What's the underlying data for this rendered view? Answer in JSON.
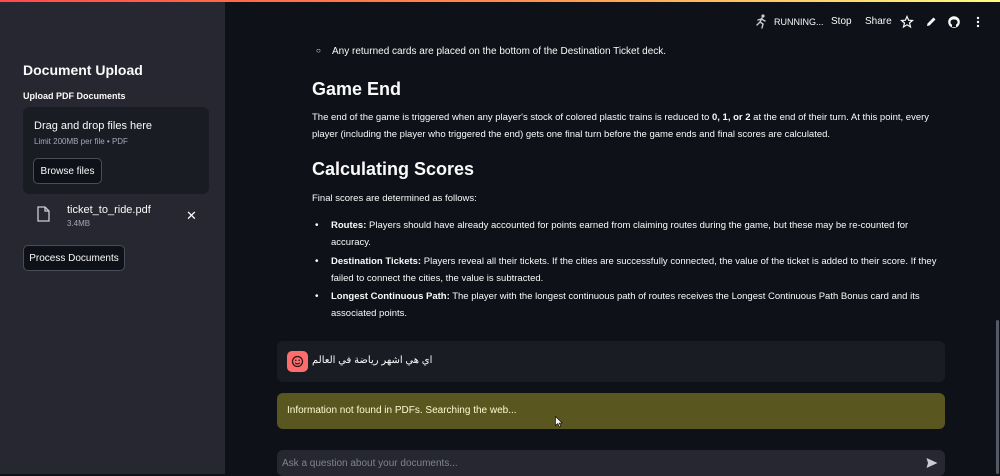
{
  "sidebar": {
    "title": "Document Upload",
    "upload_label": "Upload PDF Documents",
    "dropzone_title": "Drag and drop files here",
    "dropzone_sub": "Limit 200MB per file • PDF",
    "browse_label": "Browse files",
    "file": {
      "name": "ticket_to_ride.pdf",
      "size": "3.4MB",
      "close": "✕"
    },
    "process_label": "Process Documents"
  },
  "header": {
    "status": "RUNNING...",
    "stop_label": "Stop",
    "share_label": "Share",
    "icons": [
      "runner-icon",
      "star-icon",
      "pencil-icon",
      "github-icon",
      "more-icon"
    ]
  },
  "main": {
    "prev_item": "Any returned cards are placed on the bottom of the Destination Ticket deck.",
    "game_end_heading": "Game End",
    "game_end_text_a": "The end of the game is triggered when any player's stock of colored plastic trains is reduced to ",
    "game_end_text_bold": "0, 1, or 2",
    "game_end_text_b": " at the end of their turn. At this point, every player (including the player who triggered the end) gets one final turn before the game ends and final scores are calculated.",
    "scores_heading": "Calculating Scores",
    "scores_intro": "Final scores are determined as follows:",
    "bullets": [
      {
        "term": "Routes:",
        "text": " Players should have already accounted for points earned from claiming routes during the game, but these may be re-counted for accuracy."
      },
      {
        "term": "Destination Tickets:",
        "text": " Players reveal all their tickets. If the cities are successfully connected, the value of the ticket is added to their score. If they failed to connect the cities, the value is subtracted."
      },
      {
        "term": "Longest Continuous Path:",
        "text": " The player with the longest continuous path of routes receives the Longest Continuous Path Bonus card and its associated points."
      }
    ]
  },
  "chat": {
    "user_message": "اي هي اشهر رياضة في العالم",
    "assistant_message": "Information not found in PDFs. Searching the web...",
    "input_placeholder": "Ask a question about your documents..."
  },
  "colors": {
    "background": "#0e1117",
    "sidebar": "#262730",
    "warning_bg": "#5a5620",
    "avatar": "#ff6c6c"
  }
}
